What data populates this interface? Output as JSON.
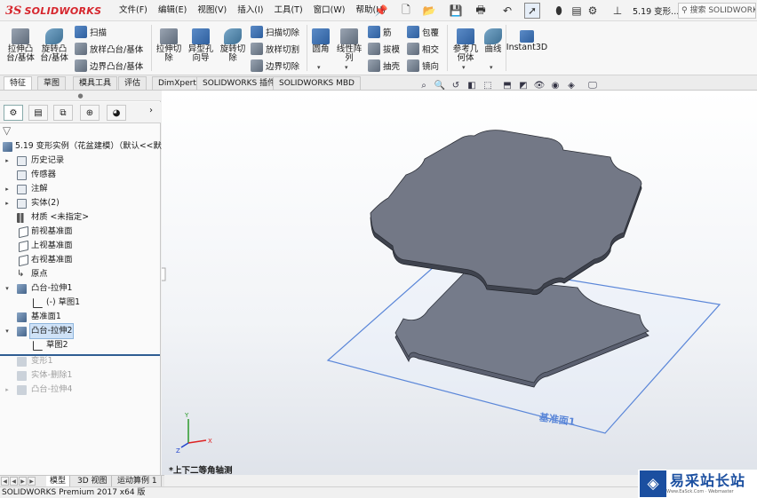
{
  "titlebar": {
    "brand_mark": "3S",
    "brand": "SOLIDWORKS",
    "menus": [
      "文件(F)",
      "编辑(E)",
      "视图(V)",
      "插入(I)",
      "工具(T)",
      "窗口(W)",
      "帮助(H)"
    ],
    "document_title": "5.19 变形...",
    "search_placeholder": "搜索 SOLIDWORKS"
  },
  "ribbon": {
    "extrude_boss": "拉伸凸\n台/基体",
    "revolve_boss": "旋转凸\n台/基体",
    "sweep": "扫描",
    "loft": "放样凸台/基体",
    "boundary_boss": "边界凸台/基体",
    "extrude_cut": "拉伸切\n除",
    "hole_wizard": "异型孔\n向导",
    "revolve_cut": "旋转切\n除",
    "swept_cut": "扫描切除",
    "lofted_cut": "放样切割",
    "boundary_cut": "边界切除",
    "fillet": "圆角",
    "linear_pattern": "线性阵\n列",
    "rib": "筋",
    "draft": "拔模",
    "shell": "抽壳",
    "wrap": "包覆",
    "intersect": "相交",
    "mirror": "镜向",
    "reference_geometry": "参考几\n何体",
    "curves": "曲线",
    "instant3d": "Instant3D"
  },
  "tabs": [
    "特征",
    "草图",
    "模具工具",
    "评估",
    "DimXpert",
    "SOLIDWORKS 插件",
    "SOLIDWORKS MBD"
  ],
  "tree": {
    "root": "5.19 变形实例（花盆建模）（默认<<默认",
    "items": [
      {
        "label": "历史记录"
      },
      {
        "label": "传感器"
      },
      {
        "label": "注解"
      },
      {
        "label": "实体(2)"
      },
      {
        "label": "材质 <未指定>"
      },
      {
        "label": "前视基准面"
      },
      {
        "label": "上视基准面"
      },
      {
        "label": "右视基准面"
      },
      {
        "label": "原点"
      },
      {
        "label": "凸台-拉伸1"
      },
      {
        "label": "(-) 草图1"
      },
      {
        "label": "基准面1"
      },
      {
        "label": "凸台-拉伸2"
      },
      {
        "label": "草图2"
      },
      {
        "label": "变形1"
      },
      {
        "label": "实体-删除1"
      },
      {
        "label": "凸台-拉伸4"
      }
    ]
  },
  "viewport": {
    "view_label": "*上下二等角轴测",
    "plane_label": "基准面1",
    "triad": {
      "x": "X",
      "y": "Y",
      "z": "Z"
    }
  },
  "bottom_tabs": [
    "模型",
    "3D 视图",
    "运动算例 1"
  ],
  "statusbar": {
    "text": "SOLIDWORKS Premium 2017 x64 版"
  },
  "watermark": {
    "text": "易采站长站",
    "sub": "Www.EaSck.Com · Webmaster"
  },
  "colors": {
    "brand": "#d6262d",
    "part_face": "#737886",
    "selection": "#cfe2f7",
    "plane_edge": "#5a86d8"
  }
}
